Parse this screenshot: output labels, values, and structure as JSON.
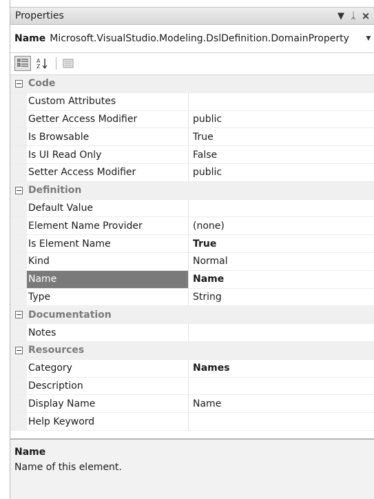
{
  "window": {
    "title": "Properties"
  },
  "object_selector": {
    "label": "Name",
    "value": "Microsoft.VisualStudio.Modeling.DslDefinition.DomainProperty"
  },
  "toolbar": {
    "categorized_icon": "categorized-icon",
    "alphabetical_icon": "alphabetical-icon",
    "property_pages_icon": "property-pages-icon"
  },
  "categories": [
    {
      "name": "Code",
      "rows": [
        {
          "key": "Custom Attributes",
          "value": ""
        },
        {
          "key": "Getter Access Modifier",
          "value": "public"
        },
        {
          "key": "Is Browsable",
          "value": "True"
        },
        {
          "key": "Is UI Read Only",
          "value": "False"
        },
        {
          "key": "Setter Access Modifier",
          "value": "public"
        }
      ]
    },
    {
      "name": "Definition",
      "rows": [
        {
          "key": "Default Value",
          "value": ""
        },
        {
          "key": "Element Name Provider",
          "value": "(none)"
        },
        {
          "key": "Is Element Name",
          "value": "True",
          "bold": true
        },
        {
          "key": "Kind",
          "value": "Normal"
        },
        {
          "key": "Name",
          "value": "Name",
          "bold": true,
          "selected": true
        },
        {
          "key": "Type",
          "value": "String"
        }
      ]
    },
    {
      "name": "Documentation",
      "rows": [
        {
          "key": "Notes",
          "value": ""
        }
      ]
    },
    {
      "name": "Resources",
      "rows": [
        {
          "key": "Category",
          "value": "Names",
          "bold": true
        },
        {
          "key": "Description",
          "value": ""
        },
        {
          "key": "Display Name",
          "value": "Name"
        },
        {
          "key": "Help Keyword",
          "value": ""
        }
      ]
    }
  ],
  "description": {
    "title": "Name",
    "text": "Name of this element."
  },
  "colors": {
    "selected_row": "#7a7a7a",
    "category_bg": "#f0f0f0",
    "category_text": "#7a7a7a"
  }
}
